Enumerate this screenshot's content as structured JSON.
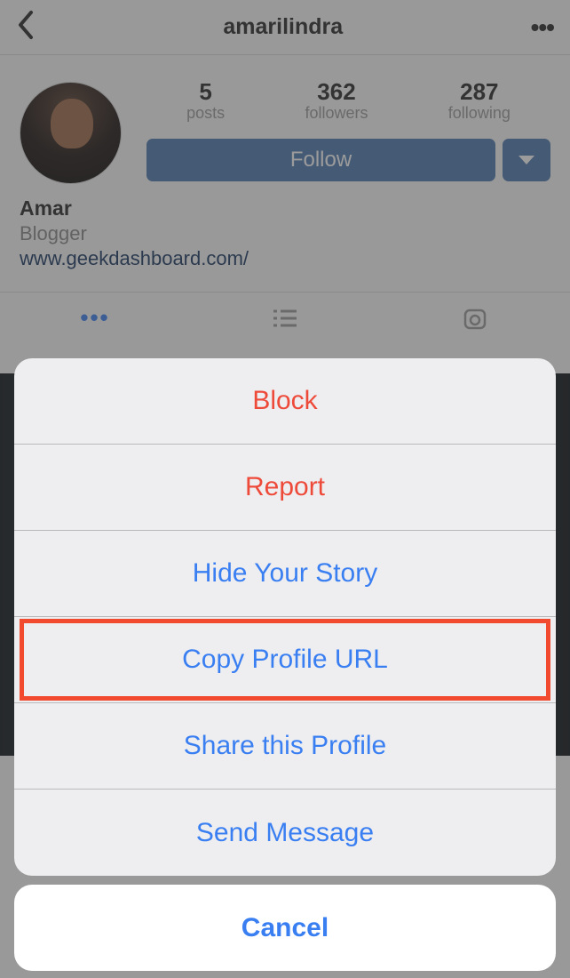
{
  "header": {
    "username": "amarilindra"
  },
  "stats": {
    "posts": {
      "value": "5",
      "label": "posts"
    },
    "followers": {
      "value": "362",
      "label": "followers"
    },
    "following": {
      "value": "287",
      "label": "following"
    }
  },
  "follow_button": "Follow",
  "bio": {
    "name": "Amar",
    "category": "Blogger",
    "link": "www.geekdashboard.com/"
  },
  "action_sheet": {
    "block": "Block",
    "report": "Report",
    "hide_story": "Hide Your Story",
    "copy_url": "Copy Profile URL",
    "share": "Share this Profile",
    "send_message": "Send Message",
    "cancel": "Cancel"
  }
}
